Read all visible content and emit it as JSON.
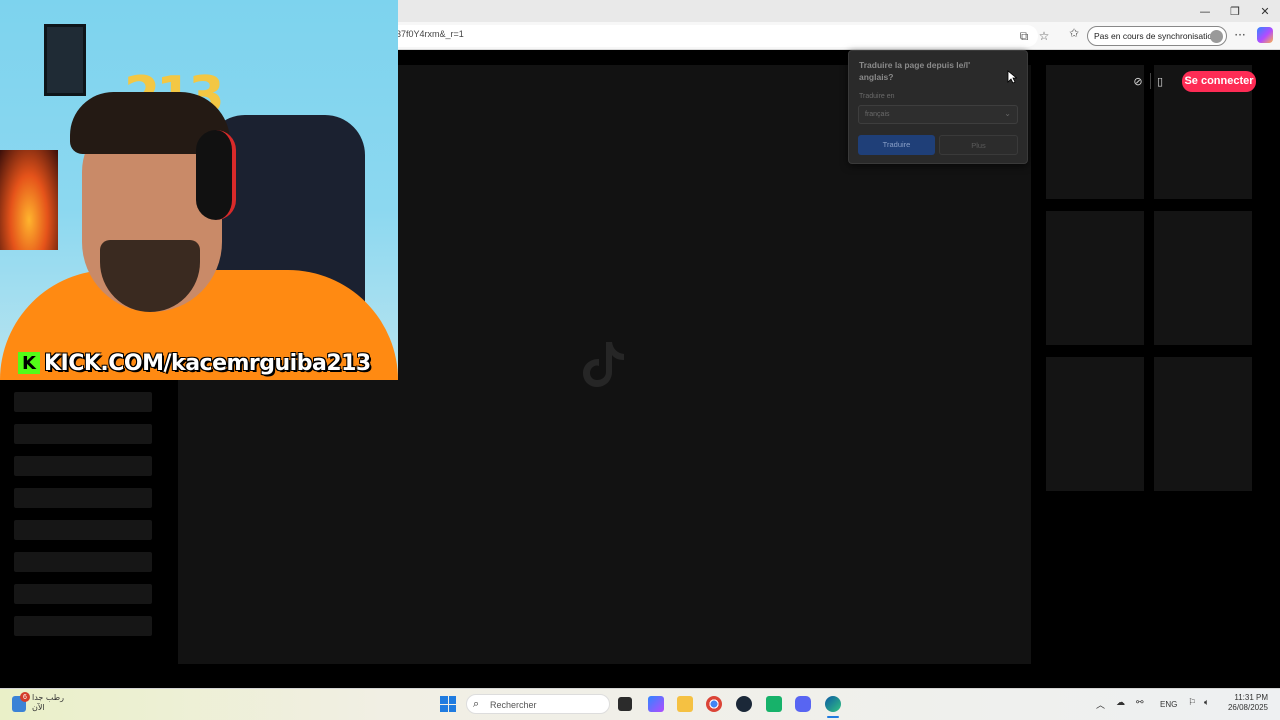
{
  "browser": {
    "url": "37f0Y4rxm&_r=1",
    "sync_label": "Pas en cours de synchronisation",
    "window_controls": [
      "—",
      "❐",
      "✕"
    ],
    "more_menu": "···"
  },
  "translate_popup": {
    "title": "Traduire la page depuis le/l' anglais?",
    "translate_to_label": "Traduire en",
    "language_value": "français",
    "translate_button": "Traduire",
    "more_button": "Plus"
  },
  "tiktok_header": {
    "login_button": "Se connecter",
    "brand_color": "#fe2c55"
  },
  "webcam": {
    "balloons": "213",
    "channel_handle": "KICK.COM/kacemrguiba213",
    "platform_badge": "K"
  },
  "taskbar": {
    "weather_badge_count": "6",
    "weather_line1": "رطب جدا",
    "weather_line2": "الآن",
    "search_placeholder": "Rechercher",
    "language": "ENG",
    "time": "11:31 PM",
    "date": "26/08/2025"
  }
}
